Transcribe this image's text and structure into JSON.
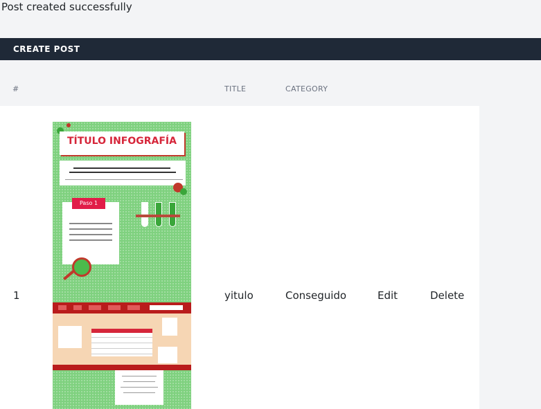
{
  "flash": {
    "message": "Post created successfully"
  },
  "toolbar": {
    "create_label": "CREATE POST"
  },
  "table": {
    "headers": {
      "number": "#",
      "title": "TITLE",
      "category": "CATEGORY"
    },
    "rows": [
      {
        "number": "1",
        "title": "yitulo",
        "category": "Conseguido",
        "edit_label": "Edit",
        "delete_label": "Delete",
        "thumbnail": {
          "heading": "TÍTULO INFOGRAFÍA",
          "step_label": "Paso 1"
        }
      }
    ]
  },
  "colors": {
    "header_bar": "#1f2937",
    "thumbnail_bg": "#7fd17f",
    "accent_red": "#d6263a"
  }
}
